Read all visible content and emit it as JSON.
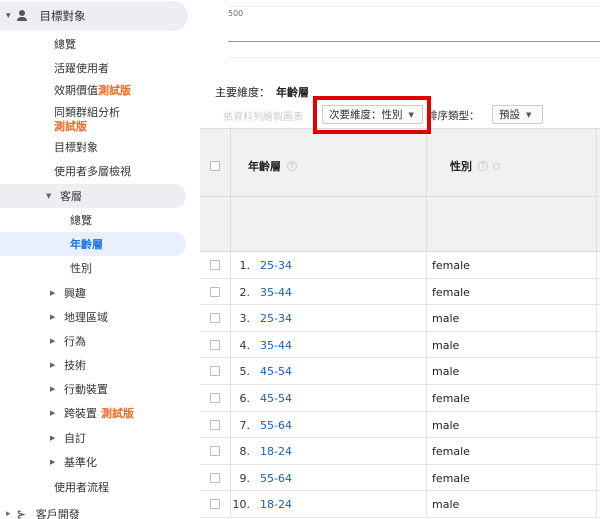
{
  "sidebar": {
    "header_label": "目標對象",
    "items": [
      {
        "label": "總覽"
      },
      {
        "label": "活躍使用者"
      },
      {
        "label": "效期價值",
        "beta": "測試版"
      },
      {
        "label": "同類群組分析",
        "beta": "測試版"
      },
      {
        "label": "目標對象"
      },
      {
        "label": "使用者多層檢視"
      }
    ],
    "demographics": {
      "label": "客層",
      "children": [
        {
          "label": "總覽"
        },
        {
          "label": "年齡層"
        },
        {
          "label": "性別"
        }
      ]
    },
    "collapsed": [
      {
        "label": "興趣"
      },
      {
        "label": "地理區域"
      },
      {
        "label": "行為"
      },
      {
        "label": "技術"
      },
      {
        "label": "行動裝置"
      },
      {
        "label": "跨裝置",
        "beta": "測試版"
      },
      {
        "label": "自訂"
      },
      {
        "label": "基準化"
      }
    ],
    "user_flow": "使用者流程",
    "acquisition": "客戶開發"
  },
  "chart": {
    "y_tick": "500"
  },
  "primary_dimension": {
    "label": "主要維度：",
    "value": "年齡層"
  },
  "toolbar": {
    "plot_rows": "依資料列繪製圖表",
    "secondary_dimension": "次要維度：性別",
    "sort_type_label": "排序類型：",
    "sort_type_value": "預設"
  },
  "table": {
    "columns": [
      "年齡層",
      "性別"
    ],
    "rows": [
      {
        "num": "1.",
        "age": "25-34",
        "gender": "female"
      },
      {
        "num": "2.",
        "age": "35-44",
        "gender": "female"
      },
      {
        "num": "3.",
        "age": "25-34",
        "gender": "male"
      },
      {
        "num": "4.",
        "age": "35-44",
        "gender": "male"
      },
      {
        "num": "5.",
        "age": "45-54",
        "gender": "male"
      },
      {
        "num": "6.",
        "age": "45-54",
        "gender": "female"
      },
      {
        "num": "7.",
        "age": "55-64",
        "gender": "male"
      },
      {
        "num": "8.",
        "age": "18-24",
        "gender": "female"
      },
      {
        "num": "9.",
        "age": "55-64",
        "gender": "female"
      },
      {
        "num": "10.",
        "age": "18-24",
        "gender": "male"
      }
    ]
  },
  "colors": {
    "link": "#1a5fb4",
    "beta": "#ec6a28",
    "highlight": "#e00000",
    "active_bg": "#e8f0fe"
  }
}
